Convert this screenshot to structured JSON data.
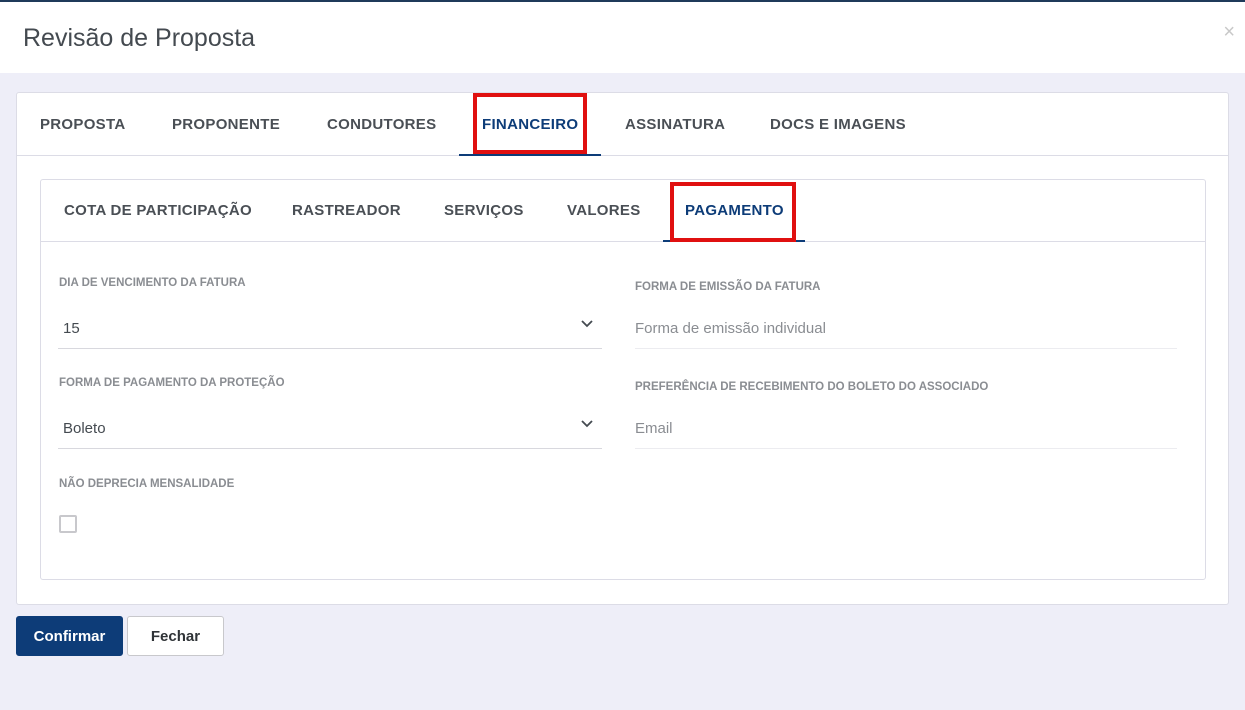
{
  "modal": {
    "title": "Revisão de Proposta",
    "close_label": "×"
  },
  "tabs": [
    {
      "label": "PROPOSTA"
    },
    {
      "label": "PROPONENTE"
    },
    {
      "label": "CONDUTORES"
    },
    {
      "label": "FINANCEIRO",
      "active": true
    },
    {
      "label": "ASSINATURA"
    },
    {
      "label": "DOCS E IMAGENS"
    }
  ],
  "subtabs": [
    {
      "label": "COTA DE PARTICIPAÇÃO"
    },
    {
      "label": "RASTREADOR"
    },
    {
      "label": "SERVIÇOS"
    },
    {
      "label": "VALORES"
    },
    {
      "label": "PAGAMENTO",
      "active": true
    }
  ],
  "form": {
    "dia_vencimento": {
      "label": "DIA DE VENCIMENTO DA FATURA",
      "value": "15"
    },
    "forma_emissao": {
      "label": "FORMA DE EMISSÃO DA FATURA",
      "value": "Forma de emissão individual"
    },
    "forma_pagamento": {
      "label": "FORMA DE PAGAMENTO DA PROTEÇÃO",
      "value": "Boleto"
    },
    "preferencia_boleto": {
      "label": "PREFERÊNCIA DE RECEBIMENTO DO BOLETO DO ASSOCIADO",
      "value": "Email"
    },
    "nao_deprecia": {
      "label": "NÃO DEPRECIA MENSALIDADE",
      "checked": false
    }
  },
  "actions": {
    "confirm_label": "Confirmar",
    "close_label": "Fechar"
  },
  "colors": {
    "primary": "#0d3c78",
    "highlight": "#e01010",
    "background": "#eeeef8"
  }
}
